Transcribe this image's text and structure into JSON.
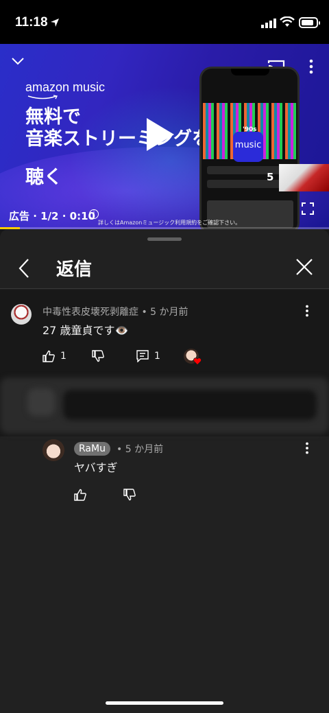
{
  "status_bar": {
    "time": "11:18"
  },
  "video_ad": {
    "brand": "amazon music",
    "headline_line1": "無料で",
    "headline_line2": "音楽ストリーミングを",
    "headline_line3": "聴く",
    "phone_tile_label": "music",
    "phone_art_label": "'90s",
    "skip_count": "5",
    "ad_meta": "広告 · 1/2 · 0:10",
    "disclaimer": "詳しくはAmazonミュージック利用規約をご確認下さい。",
    "progress_fraction": 0.06,
    "progress_color": "#ffcc00"
  },
  "panel": {
    "title": "返信"
  },
  "parent_comment": {
    "author": "中毒性表皮壊死剥離症 • 5 か月前",
    "text": "27 歳童貞です👁️",
    "like_count": "1",
    "reply_count": "1"
  },
  "reply": {
    "author": "RaMu",
    "time": "• 5 か月前",
    "text": "ヤバすぎ"
  },
  "colors": {
    "background": "#181818",
    "panel": "#212121",
    "secondary_text": "#aaaaaa",
    "heart": "#ff0000"
  }
}
